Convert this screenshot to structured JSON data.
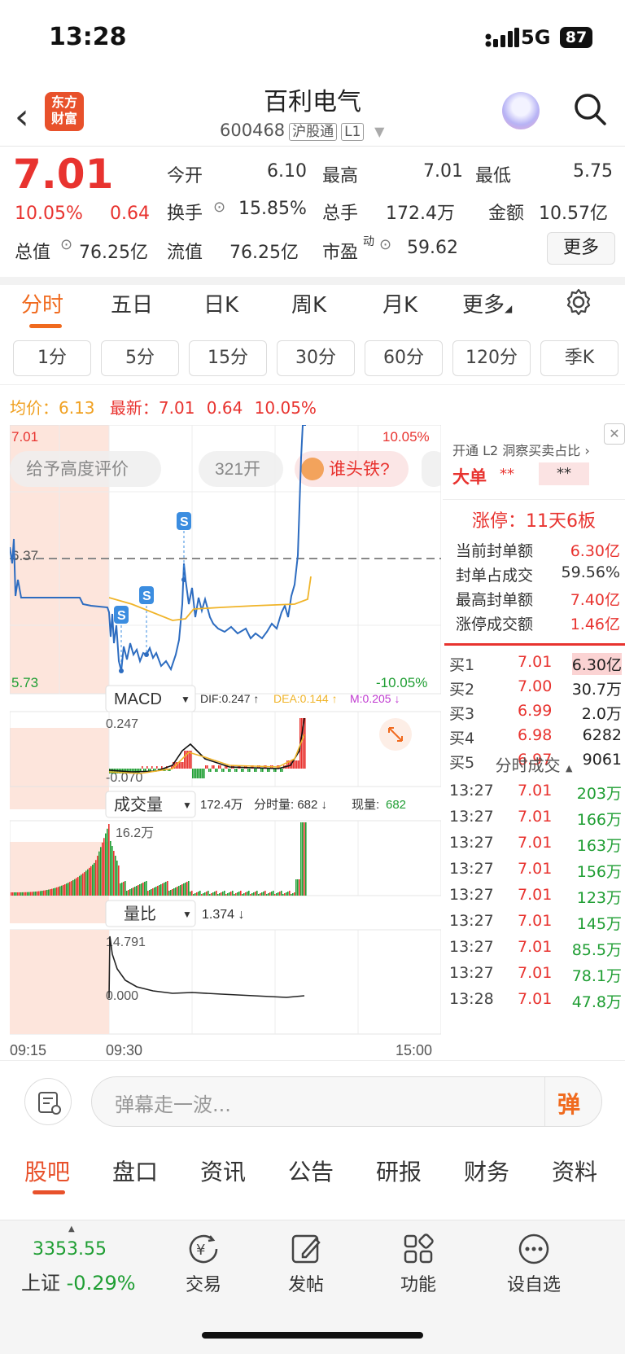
{
  "status": {
    "time": "13:28",
    "network": "5G",
    "battery": "87"
  },
  "header": {
    "title": "百利电气",
    "code": "600468",
    "tag1": "沪股通",
    "tag2": "L1",
    "logo_line1": "东方",
    "logo_line2": "财富"
  },
  "quote": {
    "price": "7.01",
    "pct": "10.05%",
    "change": "0.64",
    "open_label": "今开",
    "open": "6.10",
    "high_label": "最高",
    "high": "7.01",
    "low_label": "最低",
    "low": "5.75",
    "turnover_label": "换手",
    "turnover": "15.85%",
    "vol_label": "总手",
    "vol": "172.4万",
    "amount_label": "金额",
    "amount": "10.57亿",
    "mktcap_label": "总值",
    "mktcap": "76.25亿",
    "float_label": "流值",
    "float": "76.25亿",
    "pe_label": "市盈",
    "pe_sup": "动",
    "pe": "59.62",
    "more": "更多"
  },
  "period_tabs": [
    "分时",
    "五日",
    "日K",
    "周K",
    "月K",
    "更多"
  ],
  "interval_buttons": [
    "1分",
    "5分",
    "15分",
    "30分",
    "60分",
    "120分",
    "季K"
  ],
  "avgbar": {
    "avg_label": "均价：",
    "avg": "6.13",
    "latest_label": "最新：",
    "latest": "7.01",
    "chg": "0.64",
    "pct": "10.05%"
  },
  "chart": {
    "max_price": "7.01",
    "max_pct": "10.05%",
    "mid_price": "6.37",
    "min_price": "5.73",
    "min_pct": "-10.05%",
    "chips": [
      "给予高度评价",
      "321开",
      "谁头铁?"
    ],
    "macd_label": "MACD",
    "dif": "DIF:0.247 ↑",
    "dea": "DEA:0.144 ↑",
    "m": "M:0.205 ↓",
    "macd_top": "0.247",
    "macd_bot": "-0.070",
    "vol_label": "成交量",
    "vol_text": "172.4万",
    "vol_fs": "分时量: 682 ↓",
    "vol_now_label": "现量:",
    "vol_now": "682",
    "vol_max": "16.2万",
    "lb_label": "量比",
    "lb_val": "1.374 ↓",
    "lb_top": "14.791",
    "lb_bot": "0.000",
    "t_start": "09:15",
    "t_open": "09:30",
    "t_end": "15:00",
    "s_marker": "S"
  },
  "chart_data": {
    "type": "line",
    "x_ticks": [
      "09:15",
      "09:30",
      "15:00"
    ],
    "ylim": [
      5.73,
      7.01
    ],
    "reference_price": "6.37",
    "series": [
      {
        "name": "均价",
        "last": "6.13"
      },
      {
        "name": "最新",
        "last": "7.01"
      }
    ],
    "macd": {
      "DIF": 0.247,
      "DEA": 0.144,
      "M": 0.205
    },
    "volume_total": "172.4万",
    "volume_ratio": 1.374
  },
  "l2": {
    "link": "开通 L2 洞察买卖占比 ›",
    "big_label": "大单",
    "big_val1": "**",
    "big_val2": "**",
    "limit": "涨停：11天6板",
    "rows": [
      {
        "k": "当前封单额",
        "v": "6.30亿"
      },
      {
        "k": "封单占成交",
        "v": "59.56%"
      },
      {
        "k": "最高封单额",
        "v": "7.40亿"
      },
      {
        "k": "涨停成交额",
        "v": "1.46亿"
      }
    ],
    "bids": [
      {
        "k": "买1",
        "p": "7.01",
        "v": "6.30亿"
      },
      {
        "k": "买2",
        "p": "7.00",
        "v": "30.7万"
      },
      {
        "k": "买3",
        "p": "6.99",
        "v": "2.0万"
      },
      {
        "k": "买4",
        "p": "6.98",
        "v": "6282"
      },
      {
        "k": "买5",
        "p": "6.97",
        "v": "9061"
      }
    ],
    "ticks_label": "分时成交",
    "ticks": [
      {
        "t": "13:27",
        "p": "7.01",
        "v": "203万"
      },
      {
        "t": "13:27",
        "p": "7.01",
        "v": "166万"
      },
      {
        "t": "13:27",
        "p": "7.01",
        "v": "163万"
      },
      {
        "t": "13:27",
        "p": "7.01",
        "v": "156万"
      },
      {
        "t": "13:27",
        "p": "7.01",
        "v": "123万"
      },
      {
        "t": "13:27",
        "p": "7.01",
        "v": "145万"
      },
      {
        "t": "13:27",
        "p": "7.01",
        "v": "85.5万"
      },
      {
        "t": "13:27",
        "p": "7.01",
        "v": "78.1万"
      },
      {
        "t": "13:28",
        "p": "7.01",
        "v": "47.8万"
      }
    ]
  },
  "danmu": {
    "placeholder": "弹幕走一波...",
    "btn": "弹"
  },
  "bottom_tabs": [
    "股吧",
    "盘口",
    "资讯",
    "公告",
    "研报",
    "财务",
    "资料"
  ],
  "nav": {
    "index_val": "3353.55",
    "index_name": "上证",
    "index_pct": "-0.29%",
    "items": [
      "交易",
      "发帖",
      "功能",
      "设自选"
    ]
  }
}
